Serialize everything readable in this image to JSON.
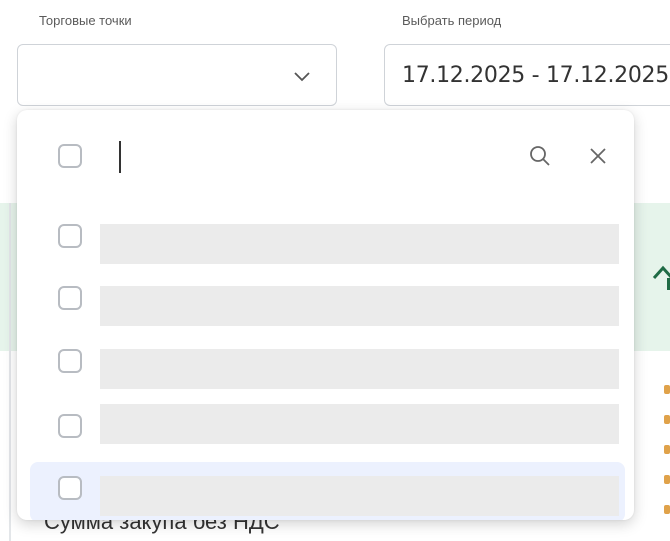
{
  "filters": {
    "points_label": "Торговые точки",
    "period_label": "Выбрать период",
    "points_value": "",
    "period_value": "17.12.2025 - 17.12.2025"
  },
  "dropdown": {
    "search_value": "",
    "row_count": 5,
    "highlighted_row_index": 4
  },
  "background": {
    "partial_text": "Сумма закупа без НДС",
    "partial_paren": "( / )"
  },
  "icons": {
    "select_chevron": "chevron-down-icon",
    "search": "search-icon",
    "clear": "close-icon",
    "scroll_up": "arrow-up-icon",
    "scroll_down": "arrow-down-icon"
  },
  "colors": {
    "border": "#cfd3d8",
    "band": "#e6f4eb",
    "highlight": "#ecf1fe",
    "placeholder_bar": "#ebebeb",
    "scroll_thumb": "#909090"
  }
}
